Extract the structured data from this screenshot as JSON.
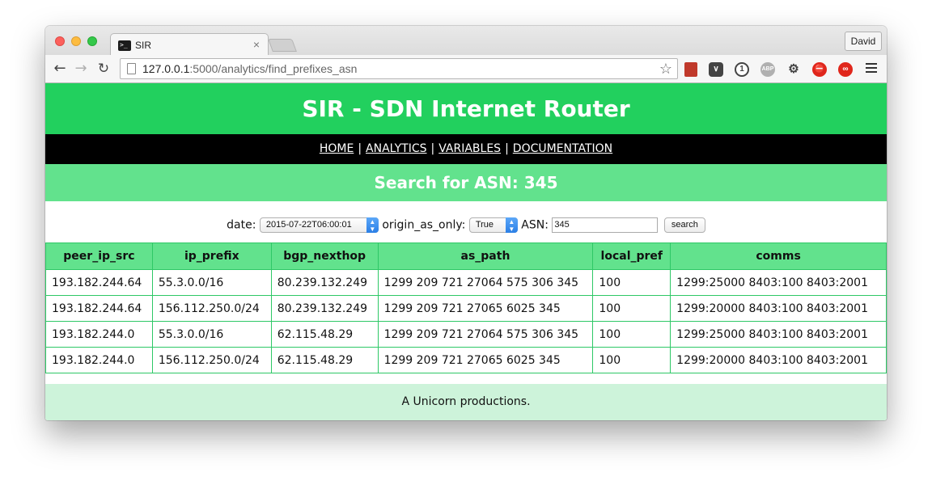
{
  "browser": {
    "tab_title": "SIR",
    "tab_close": "×",
    "profile_name": "David",
    "url_host": "127.0.0.1",
    "url_rest": ":5000/analytics/find_prefixes_asn",
    "icons": [
      "back-arrow-icon",
      "forward-arrow-icon",
      "reload-icon",
      "page-icon",
      "star-icon",
      "bookmark-extension-icon",
      "pocket-icon",
      "1password-icon",
      "adblock-plus-icon",
      "wrench-icon",
      "stop-icon",
      "creative-cloud-icon",
      "menu-icon"
    ]
  },
  "page": {
    "title": "SIR - SDN Internet Router",
    "nav": [
      "HOME",
      "ANALYTICS",
      "VARIABLES",
      "DOCUMENTATION"
    ],
    "nav_separator": "|",
    "subtitle": "Search for ASN: 345"
  },
  "form": {
    "date_label": "date:",
    "date_value": "2015-07-22T06:00:01",
    "origin_label": "origin_as_only:",
    "origin_value": "True",
    "asn_label": "ASN:",
    "asn_value": "345",
    "search_label": "search"
  },
  "table": {
    "headers": [
      "peer_ip_src",
      "ip_prefix",
      "bgp_nexthop",
      "as_path",
      "local_pref",
      "comms"
    ],
    "rows": [
      [
        "193.182.244.64",
        "55.3.0.0/16",
        "80.239.132.249",
        "1299 209 721 27064 575 306 345",
        "100",
        "1299:25000 8403:100 8403:2001"
      ],
      [
        "193.182.244.64",
        "156.112.250.0/24",
        "80.239.132.249",
        "1299 209 721 27065 6025 345",
        "100",
        "1299:20000 8403:100 8403:2001"
      ],
      [
        "193.182.244.0",
        "55.3.0.0/16",
        "62.115.48.29",
        "1299 209 721 27064 575 306 345",
        "100",
        "1299:25000 8403:100 8403:2001"
      ],
      [
        "193.182.244.0",
        "156.112.250.0/24",
        "62.115.48.29",
        "1299 209 721 27065 6025 345",
        "100",
        "1299:20000 8403:100 8403:2001"
      ]
    ]
  },
  "footer": "A Unicorn productions.",
  "colors": {
    "header_green": "#22d05e",
    "subheader_green": "#62e28d",
    "footer_green": "#cdf3da",
    "nav_black": "#000000"
  }
}
